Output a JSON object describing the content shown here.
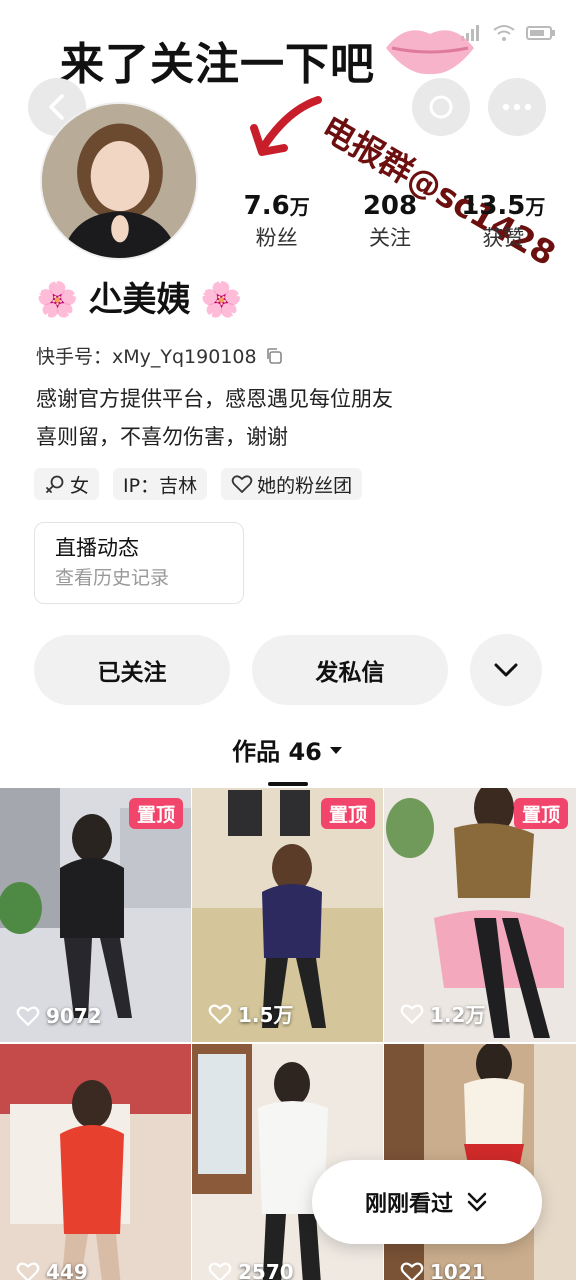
{
  "overlay": {
    "headline": "来了关注一下吧",
    "tag": "电报群@sc1428"
  },
  "profile": {
    "name": "尐美姨",
    "flower": "🌸",
    "user_id": "快手号：xMy_Yq190108",
    "bio_line1": "感谢官方提供平台，感恩遇见每位朋友",
    "bio_line2": "喜则留，不喜勿伤害，谢谢",
    "tags": [
      {
        "icon": "female-icon",
        "label": "女"
      },
      {
        "icon": "",
        "label": "IP：吉林"
      },
      {
        "icon": "heart-outline-icon",
        "label": "她的粉丝团"
      }
    ]
  },
  "stats": [
    {
      "value": "7.6",
      "unit": "万",
      "label": "粉丝"
    },
    {
      "value": "208",
      "unit": "",
      "label": "关注"
    },
    {
      "value": "13.5",
      "unit": "万",
      "label": "获赞"
    }
  ],
  "live_card": {
    "title": "直播动态",
    "subtitle": "查看历史记录"
  },
  "actions": {
    "followed": "已关注",
    "message": "发私信"
  },
  "works_tab": {
    "label": "作品 46"
  },
  "grid": [
    {
      "pinned": true,
      "pin_label": "置顶",
      "likes": "9072",
      "color": "#8c8f95"
    },
    {
      "pinned": true,
      "pin_label": "置顶",
      "likes": "1.5万",
      "color": "#c9b48a"
    },
    {
      "pinned": true,
      "pin_label": "置顶",
      "likes": "1.2万",
      "color": "#d7cfc8"
    },
    {
      "pinned": false,
      "pin_label": "",
      "likes": "449",
      "color": "#c75f4e"
    },
    {
      "pinned": false,
      "pin_label": "",
      "likes": "2570",
      "color": "#b89c86"
    },
    {
      "pinned": false,
      "pin_label": "",
      "likes": "1021",
      "color": "#9c7e63"
    }
  ],
  "recent": {
    "label": "刚刚看过"
  },
  "colors": {
    "pin": "#f2456b",
    "button_bg": "#f1f1f2"
  }
}
